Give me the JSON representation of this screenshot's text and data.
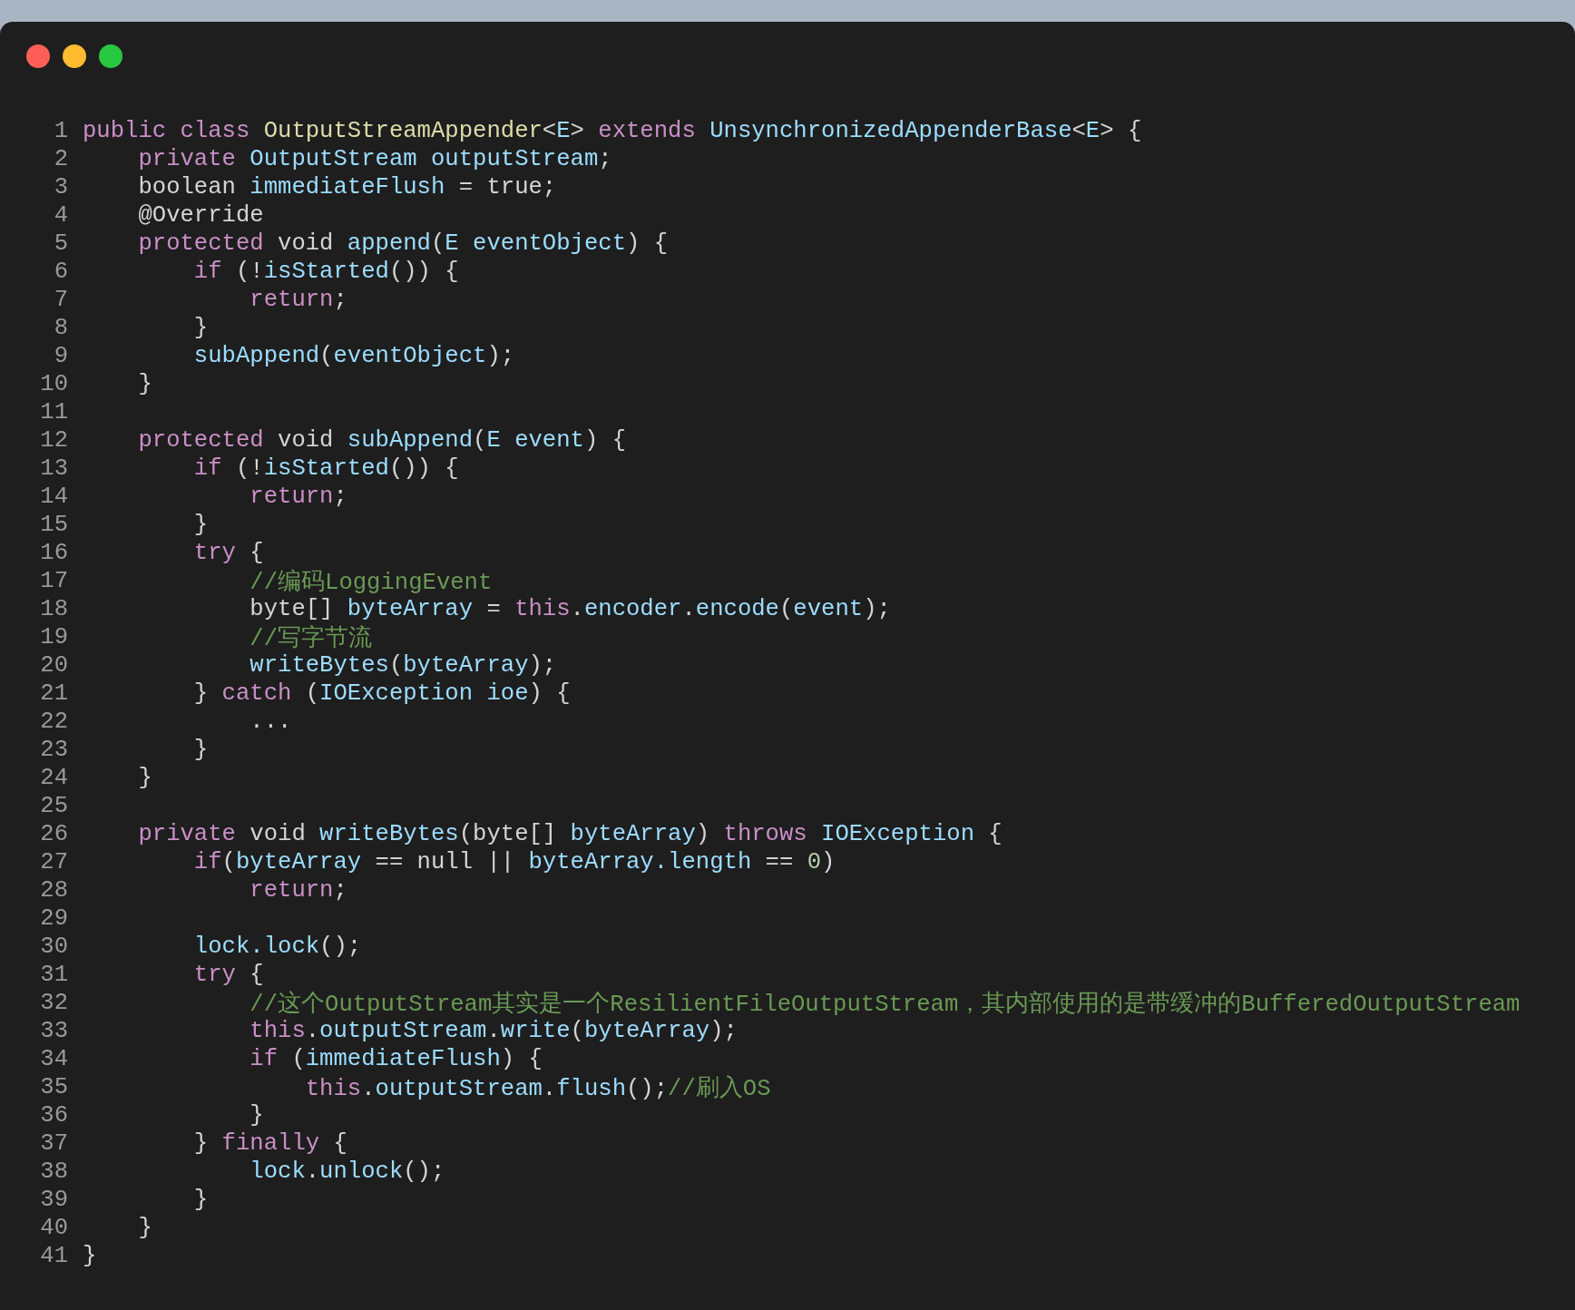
{
  "window": {
    "buttons": [
      {
        "color": "#ff5f57"
      },
      {
        "color": "#febc2e"
      },
      {
        "color": "#28c840"
      }
    ]
  },
  "code": {
    "lines": [
      {
        "number": "1",
        "tokens": [
          {
            "kind": "keyword",
            "text": "public class "
          },
          {
            "kind": "type",
            "text": "OutputStreamAppender"
          },
          {
            "kind": "plain",
            "text": "<"
          },
          {
            "kind": "name",
            "text": "E"
          },
          {
            "kind": "plain",
            "text": "> "
          },
          {
            "kind": "keyword",
            "text": "extends "
          },
          {
            "kind": "name",
            "text": "UnsynchronizedAppenderBase"
          },
          {
            "kind": "plain",
            "text": "<"
          },
          {
            "kind": "name",
            "text": "E"
          },
          {
            "kind": "plain",
            "text": "> {"
          }
        ]
      },
      {
        "number": "2",
        "tokens": [
          {
            "kind": "keyword",
            "text": "    private "
          },
          {
            "kind": "name",
            "text": "OutputStream outputStream"
          },
          {
            "kind": "plain",
            "text": ";"
          }
        ]
      },
      {
        "number": "3",
        "tokens": [
          {
            "kind": "plain",
            "text": "    boolean "
          },
          {
            "kind": "name",
            "text": "immediateFlush"
          },
          {
            "kind": "plain",
            "text": " = true;"
          }
        ]
      },
      {
        "number": "4",
        "tokens": [
          {
            "kind": "plain",
            "text": "    @Override"
          }
        ]
      },
      {
        "number": "5",
        "tokens": [
          {
            "kind": "keyword",
            "text": "    protected "
          },
          {
            "kind": "plain",
            "text": "void "
          },
          {
            "kind": "name",
            "text": "append"
          },
          {
            "kind": "plain",
            "text": "("
          },
          {
            "kind": "name",
            "text": "E eventObject"
          },
          {
            "kind": "plain",
            "text": ") {"
          }
        ]
      },
      {
        "number": "6",
        "tokens": [
          {
            "kind": "keyword",
            "text": "        if "
          },
          {
            "kind": "plain",
            "text": "(!"
          },
          {
            "kind": "name",
            "text": "isStarted"
          },
          {
            "kind": "plain",
            "text": "()) {"
          }
        ]
      },
      {
        "number": "7",
        "tokens": [
          {
            "kind": "keyword",
            "text": "            return"
          },
          {
            "kind": "plain",
            "text": ";"
          }
        ]
      },
      {
        "number": "8",
        "tokens": [
          {
            "kind": "plain",
            "text": "        }"
          }
        ]
      },
      {
        "number": "9",
        "tokens": [
          {
            "kind": "name",
            "text": "        subAppend"
          },
          {
            "kind": "plain",
            "text": "("
          },
          {
            "kind": "name",
            "text": "eventObject"
          },
          {
            "kind": "plain",
            "text": ");"
          }
        ]
      },
      {
        "number": "10",
        "tokens": [
          {
            "kind": "plain",
            "text": "    }"
          }
        ]
      },
      {
        "number": "11"
      },
      {
        "number": "12",
        "tokens": [
          {
            "kind": "keyword",
            "text": "    protected "
          },
          {
            "kind": "plain",
            "text": "void "
          },
          {
            "kind": "name",
            "text": "subAppend"
          },
          {
            "kind": "plain",
            "text": "("
          },
          {
            "kind": "name",
            "text": "E event"
          },
          {
            "kind": "plain",
            "text": ") {"
          }
        ]
      },
      {
        "number": "13",
        "tokens": [
          {
            "kind": "keyword",
            "text": "        if "
          },
          {
            "kind": "plain",
            "text": "(!"
          },
          {
            "kind": "name",
            "text": "isStarted"
          },
          {
            "kind": "plain",
            "text": "()) {"
          }
        ]
      },
      {
        "number": "14",
        "tokens": [
          {
            "kind": "keyword",
            "text": "            return"
          },
          {
            "kind": "plain",
            "text": ";"
          }
        ]
      },
      {
        "number": "15",
        "tokens": [
          {
            "kind": "plain",
            "text": "        }"
          }
        ]
      },
      {
        "number": "16",
        "tokens": [
          {
            "kind": "keyword",
            "text": "        try"
          },
          {
            "kind": "plain",
            "text": " {"
          }
        ]
      },
      {
        "number": "17",
        "tokens": [
          {
            "kind": "comment",
            "text": "            //编码LoggingEvent"
          }
        ]
      },
      {
        "number": "18",
        "tokens": [
          {
            "kind": "plain",
            "text": "            byte[] "
          },
          {
            "kind": "name",
            "text": "byteArray"
          },
          {
            "kind": "plain",
            "text": " = "
          },
          {
            "kind": "keyword",
            "text": "this"
          },
          {
            "kind": "plain",
            "text": "."
          },
          {
            "kind": "name",
            "text": "encoder"
          },
          {
            "kind": "plain",
            "text": "."
          },
          {
            "kind": "name",
            "text": "encode"
          },
          {
            "kind": "plain",
            "text": "("
          },
          {
            "kind": "name",
            "text": "event"
          },
          {
            "kind": "plain",
            "text": ");"
          }
        ]
      },
      {
        "number": "19",
        "tokens": [
          {
            "kind": "comment",
            "text": "            //写字节流"
          }
        ]
      },
      {
        "number": "20",
        "tokens": [
          {
            "kind": "name",
            "text": "            writeBytes"
          },
          {
            "kind": "plain",
            "text": "("
          },
          {
            "kind": "name",
            "text": "byteArray"
          },
          {
            "kind": "plain",
            "text": ");"
          }
        ]
      },
      {
        "number": "21",
        "tokens": [
          {
            "kind": "plain",
            "text": "        } "
          },
          {
            "kind": "keyword",
            "text": "catch"
          },
          {
            "kind": "plain",
            "text": " ("
          },
          {
            "kind": "name",
            "text": "IOException ioe"
          },
          {
            "kind": "plain",
            "text": ") {"
          }
        ]
      },
      {
        "number": "22",
        "tokens": [
          {
            "kind": "plain",
            "text": "            ..."
          }
        ]
      },
      {
        "number": "23",
        "tokens": [
          {
            "kind": "plain",
            "text": "        }"
          }
        ]
      },
      {
        "number": "24",
        "tokens": [
          {
            "kind": "plain",
            "text": "    }"
          }
        ]
      },
      {
        "number": "25"
      },
      {
        "number": "26",
        "tokens": [
          {
            "kind": "keyword",
            "text": "    private "
          },
          {
            "kind": "plain",
            "text": "void "
          },
          {
            "kind": "name",
            "text": "writeBytes"
          },
          {
            "kind": "plain",
            "text": "(byte[] "
          },
          {
            "kind": "name",
            "text": "byteArray"
          },
          {
            "kind": "plain",
            "text": ") "
          },
          {
            "kind": "keyword",
            "text": "throws "
          },
          {
            "kind": "name",
            "text": "IOException"
          },
          {
            "kind": "plain",
            "text": " {"
          }
        ]
      },
      {
        "number": "27",
        "tokens": [
          {
            "kind": "keyword",
            "text": "        if"
          },
          {
            "kind": "plain",
            "text": "("
          },
          {
            "kind": "name",
            "text": "byteArray"
          },
          {
            "kind": "plain",
            "text": " == null || "
          },
          {
            "kind": "name",
            "text": "byteArray.length"
          },
          {
            "kind": "plain",
            "text": " == "
          },
          {
            "kind": "number",
            "text": "0"
          },
          {
            "kind": "plain",
            "text": ")"
          }
        ]
      },
      {
        "number": "28",
        "tokens": [
          {
            "kind": "keyword",
            "text": "            return"
          },
          {
            "kind": "plain",
            "text": ";"
          }
        ]
      },
      {
        "number": "29"
      },
      {
        "number": "30",
        "tokens": [
          {
            "kind": "name",
            "text": "        lock.lock"
          },
          {
            "kind": "plain",
            "text": "();"
          }
        ]
      },
      {
        "number": "31",
        "tokens": [
          {
            "kind": "keyword",
            "text": "        try"
          },
          {
            "kind": "plain",
            "text": " {"
          }
        ]
      },
      {
        "number": "32",
        "tokens": [
          {
            "kind": "comment",
            "text": "            //这个OutputStream其实是一个ResilientFileOutputStream，其内部使用的是带缓冲的BufferedOutputStream"
          }
        ]
      },
      {
        "number": "33",
        "tokens": [
          {
            "kind": "keyword",
            "text": "            this"
          },
          {
            "kind": "plain",
            "text": "."
          },
          {
            "kind": "name",
            "text": "outputStream"
          },
          {
            "kind": "plain",
            "text": "."
          },
          {
            "kind": "name",
            "text": "write"
          },
          {
            "kind": "plain",
            "text": "("
          },
          {
            "kind": "name",
            "text": "byteArray"
          },
          {
            "kind": "plain",
            "text": ");"
          }
        ]
      },
      {
        "number": "34",
        "tokens": [
          {
            "kind": "keyword",
            "text": "            if"
          },
          {
            "kind": "plain",
            "text": " ("
          },
          {
            "kind": "name",
            "text": "immediateFlush"
          },
          {
            "kind": "plain",
            "text": ") {"
          }
        ]
      },
      {
        "number": "35",
        "tokens": [
          {
            "kind": "keyword",
            "text": "                this"
          },
          {
            "kind": "plain",
            "text": "."
          },
          {
            "kind": "name",
            "text": "outputStream"
          },
          {
            "kind": "plain",
            "text": "."
          },
          {
            "kind": "name",
            "text": "flush"
          },
          {
            "kind": "plain",
            "text": "();"
          },
          {
            "kind": "comment",
            "text": "//刷入OS"
          }
        ]
      },
      {
        "number": "36",
        "tokens": [
          {
            "kind": "plain",
            "text": "            }"
          }
        ]
      },
      {
        "number": "37",
        "tokens": [
          {
            "kind": "plain",
            "text": "        } "
          },
          {
            "kind": "keyword",
            "text": "finally"
          },
          {
            "kind": "plain",
            "text": " {"
          }
        ]
      },
      {
        "number": "38",
        "tokens": [
          {
            "kind": "name",
            "text": "            lock"
          },
          {
            "kind": "plain",
            "text": "."
          },
          {
            "kind": "name",
            "text": "unlock"
          },
          {
            "kind": "plain",
            "text": "();"
          }
        ]
      },
      {
        "number": "39",
        "tokens": [
          {
            "kind": "plain",
            "text": "        }"
          }
        ]
      },
      {
        "number": "40",
        "tokens": [
          {
            "kind": "plain",
            "text": "    }"
          }
        ]
      },
      {
        "number": "41",
        "tokens": [
          {
            "kind": "plain",
            "text": "}"
          }
        ]
      }
    ]
  }
}
